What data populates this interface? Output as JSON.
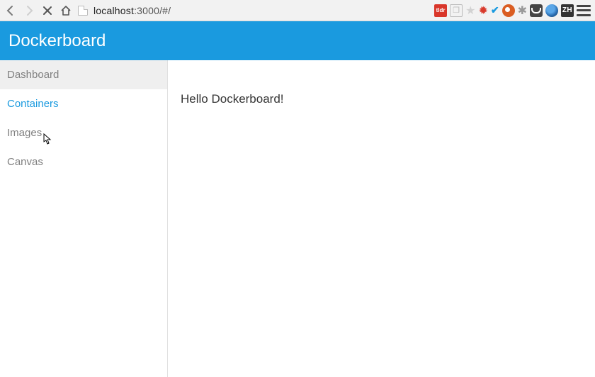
{
  "browser": {
    "url_host": "localhost",
    "url_rest": ":3000/#/",
    "ext_tldr": "tldr",
    "ext_zh": "ZH"
  },
  "app": {
    "title": "Dockerboard"
  },
  "sidebar": {
    "items": [
      {
        "label": "Dashboard"
      },
      {
        "label": "Containers"
      },
      {
        "label": "Images"
      },
      {
        "label": "Canvas"
      }
    ]
  },
  "main": {
    "greeting": "Hello Dockerboard!"
  }
}
